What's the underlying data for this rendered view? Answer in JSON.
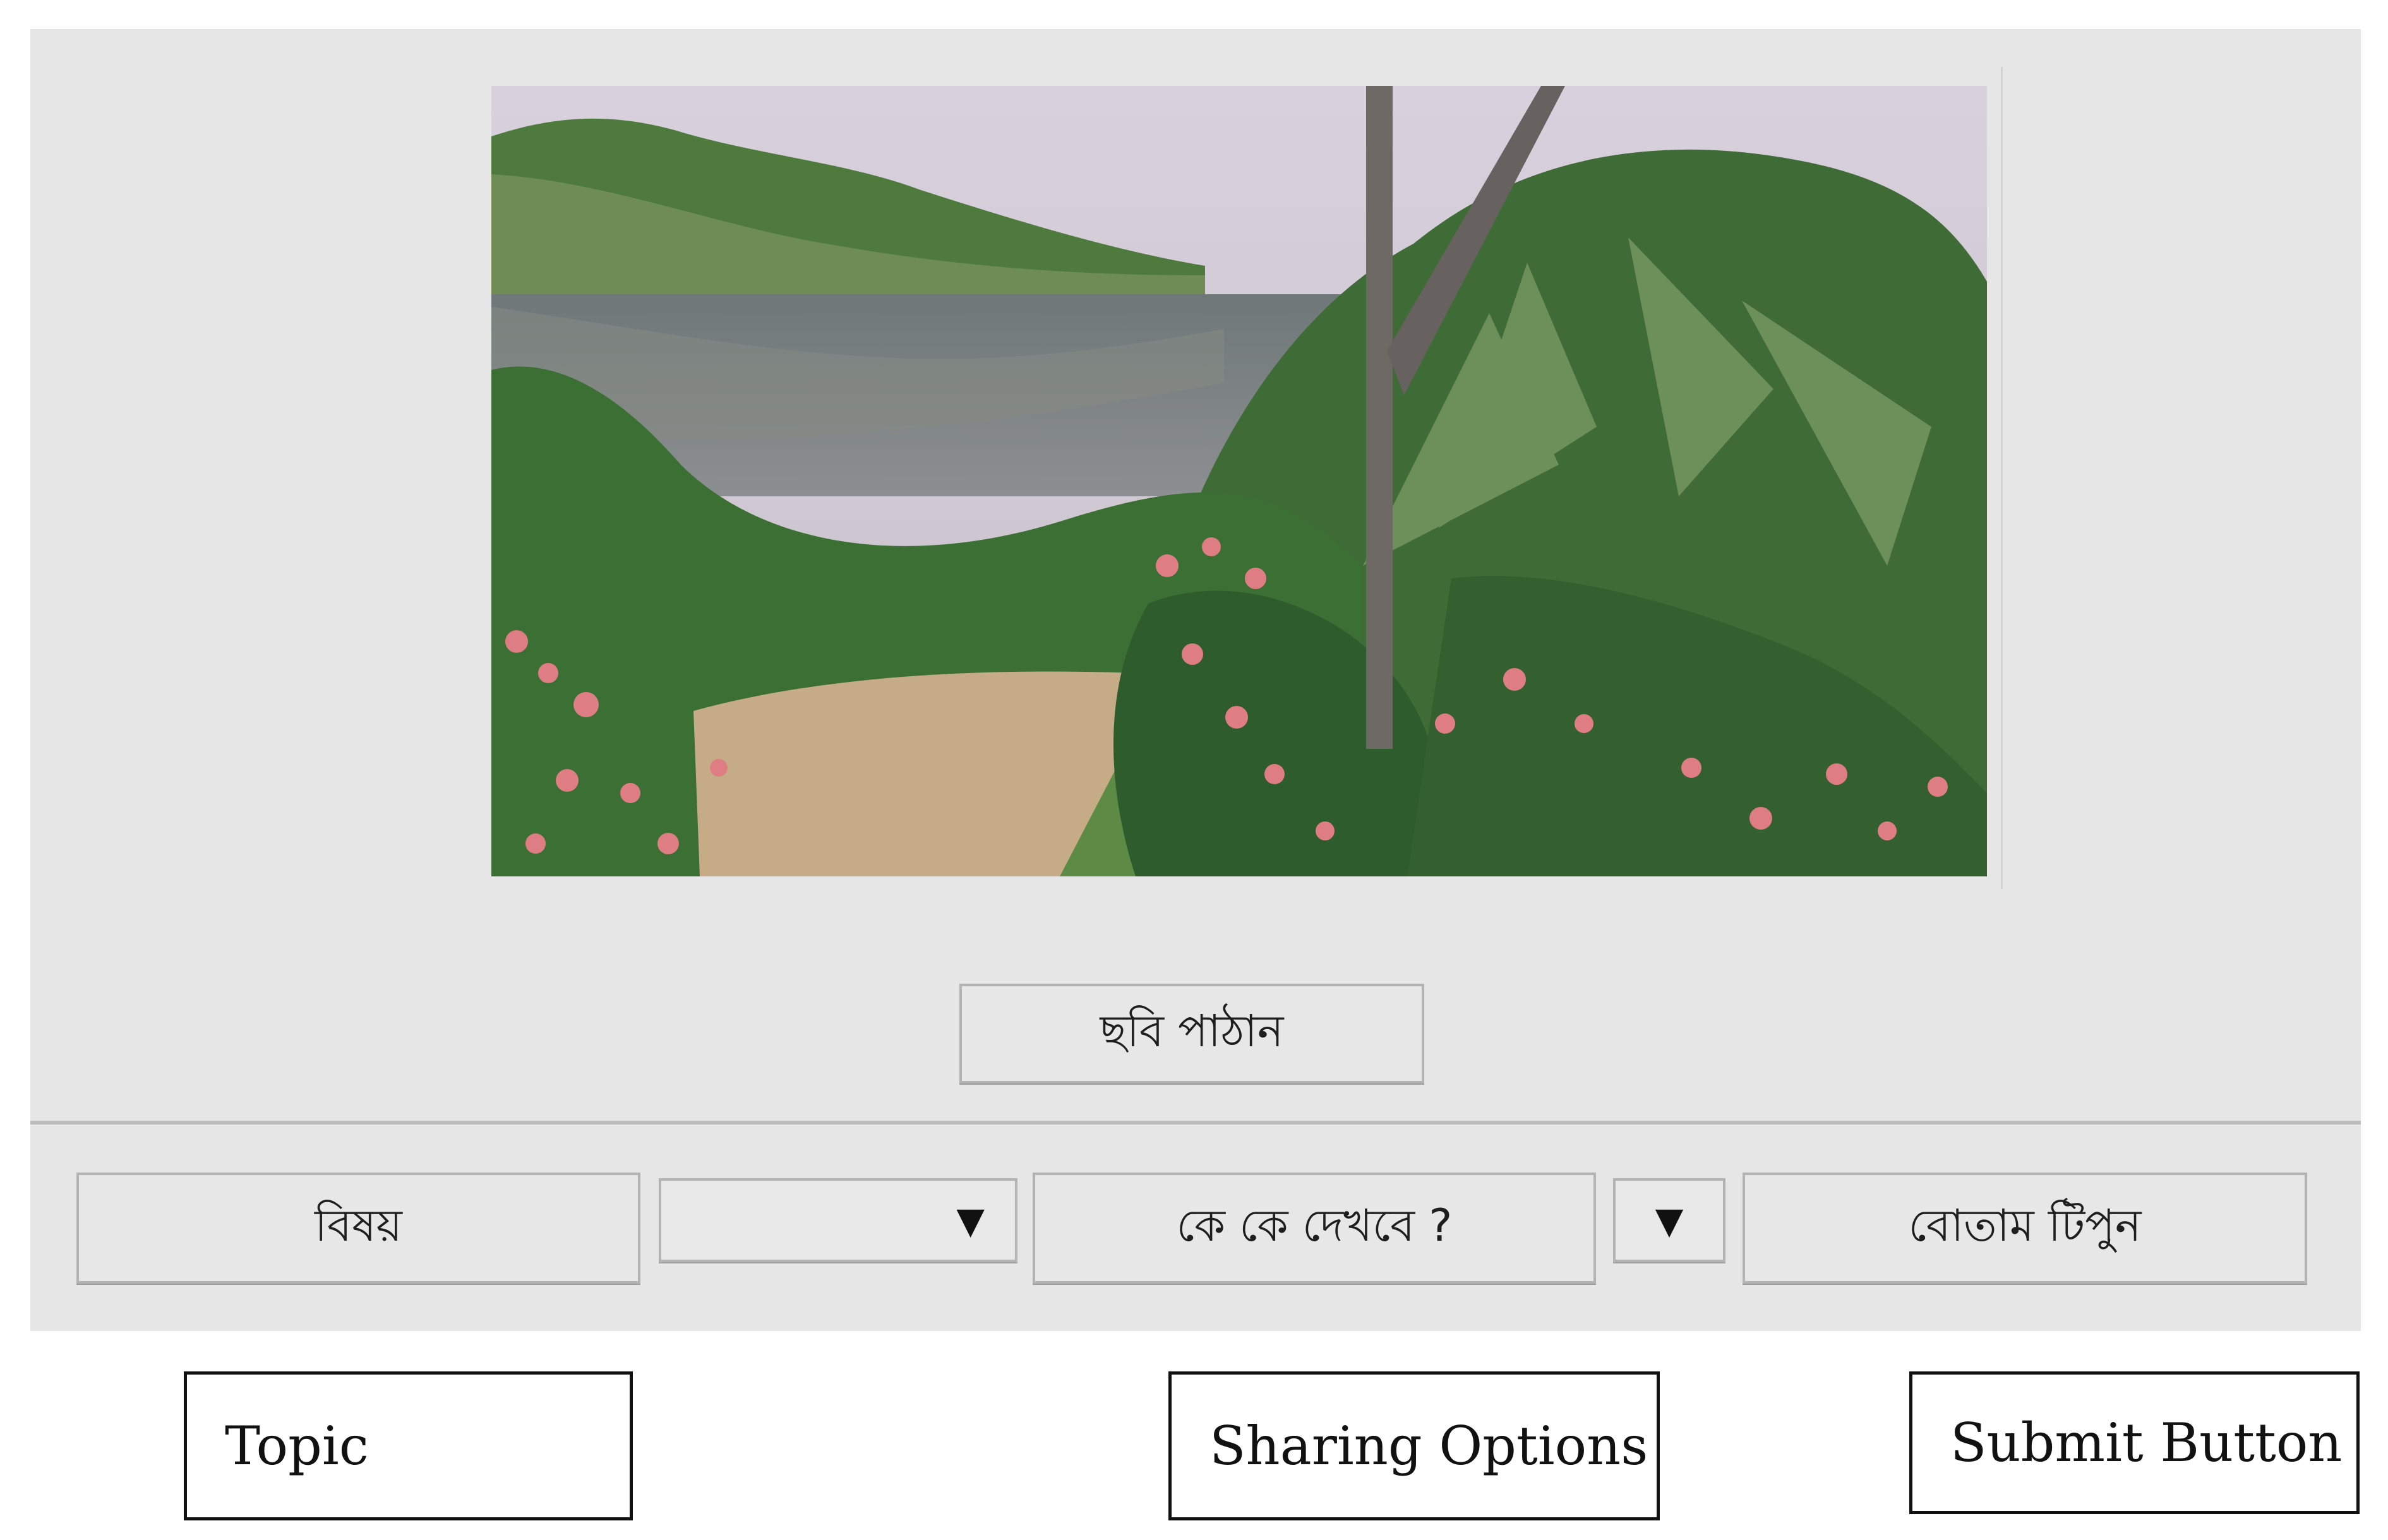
{
  "photo": {
    "subject": "lake-landscape-image"
  },
  "upload": {
    "send_photo_label": "ছবি পাঠান"
  },
  "toolbar": {
    "topic_label": "বিষয়",
    "topic_select_value": "",
    "share_label": "কে কে দেখবে ?",
    "submit_label": "বোতাম টিপুন",
    "dropdown_icon": "▼"
  },
  "annotations": {
    "topic": "Topic",
    "sharing_options": "Sharing Options",
    "submit_button": "Submit Button"
  },
  "colors": {
    "panel_bg": "#e6e6e6",
    "button_border": "#b3b3b3"
  }
}
